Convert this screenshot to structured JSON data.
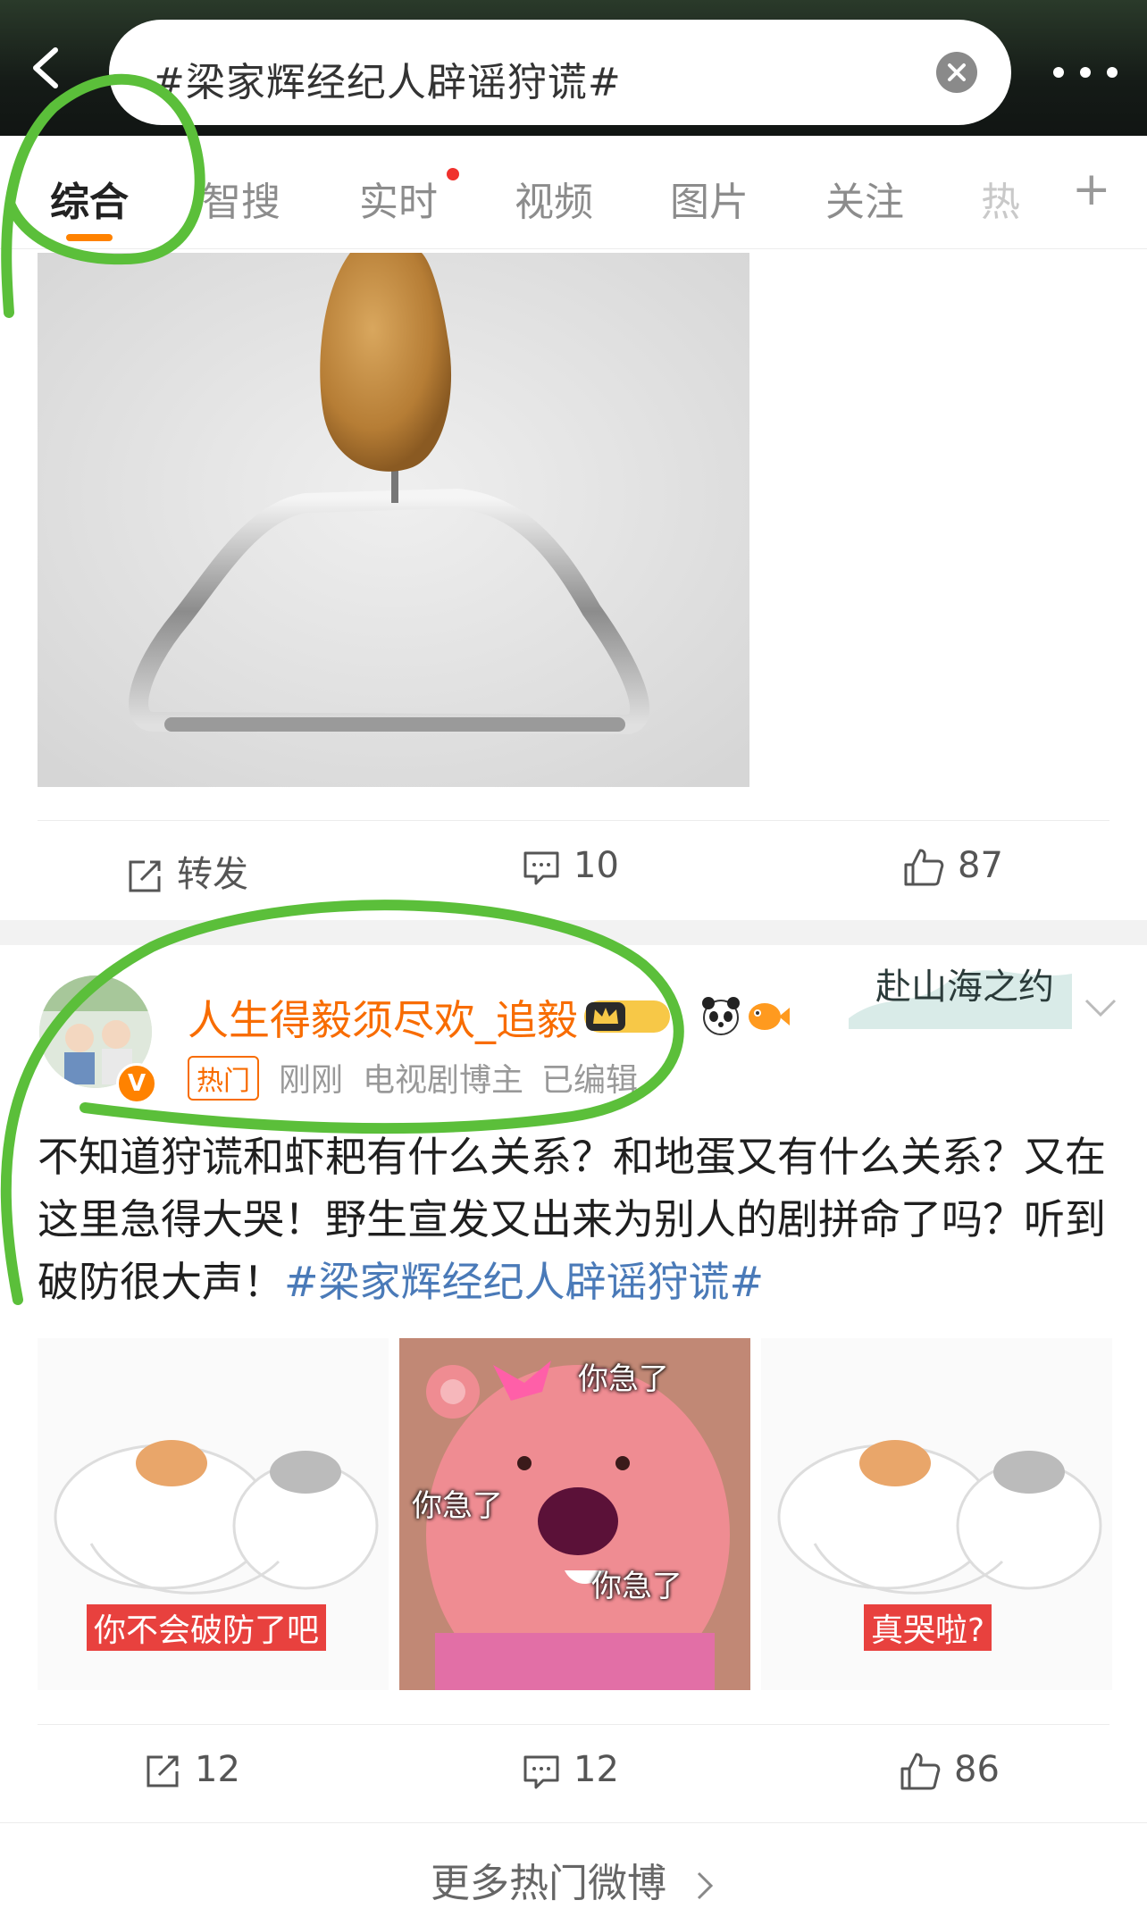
{
  "header": {
    "search_text": "#梁家辉经纪人辟谣狩谎#",
    "colors": {
      "accent": "#ff8200",
      "hashtag": "#4a7ab8",
      "username": "#f86c00",
      "annotation": "#5bbf3a"
    }
  },
  "tabs": {
    "items": [
      "综合",
      "智搜",
      "实时",
      "视频",
      "图片",
      "关注",
      "热"
    ]
  },
  "post1": {
    "repost_label": "转发",
    "comments": "10",
    "likes": "87"
  },
  "post2": {
    "username": "人生得毅须尽欢_追毅",
    "hot_badge": "热门",
    "time": "刚刚",
    "role": "电视剧博主",
    "edited": "已编辑",
    "text": "不知道狩谎和虾耙有什么关系？和地蛋又有什么关系？又在这里急得大哭！野生宣发又出来为别人的剧拼命了吗？听到破防很大声！",
    "hashtag": "#梁家辉经纪人辟谣狩谎#",
    "badge_text": "赴山海之约",
    "meme_captions": [
      "你不会破防了吧",
      "你急了",
      "你急了",
      "你急了",
      "真哭啦?"
    ],
    "reposts": "12",
    "comments": "12",
    "likes": "86"
  },
  "footer": {
    "more_label": "更多热门微博"
  }
}
